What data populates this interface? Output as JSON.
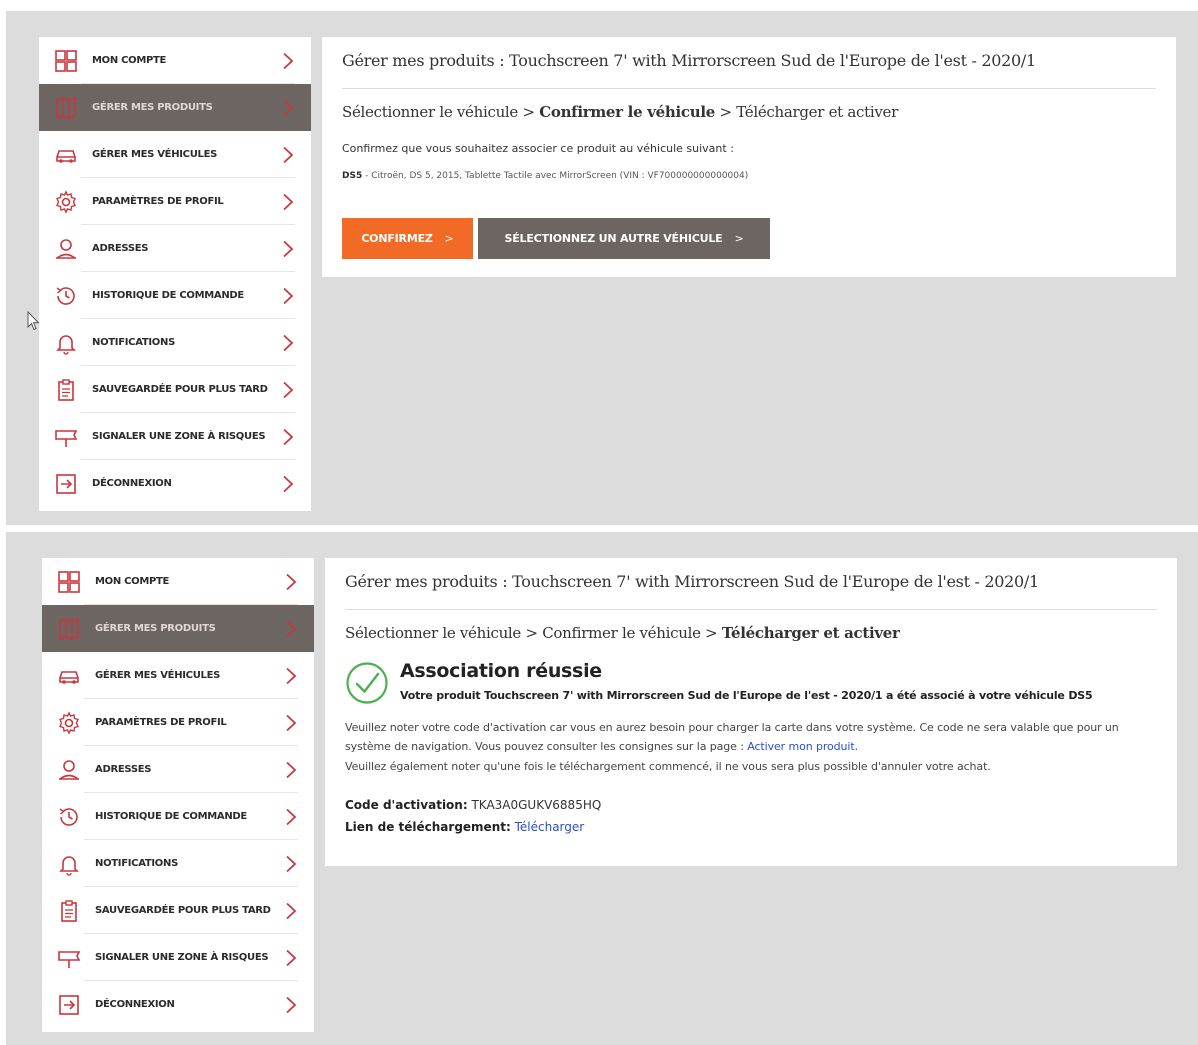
{
  "menu": [
    {
      "label": "MON COMPTE",
      "icon": "account-grid-icon",
      "name": "sidebar-item-mon-compte"
    },
    {
      "label": "GÉRER MES PRODUITS",
      "icon": "map-book-icon",
      "name": "sidebar-item-gerer-mes-produits"
    },
    {
      "label": "GÉRER MES VÉHICULES",
      "icon": "car-icon",
      "name": "sidebar-item-gerer-mes-vehicules"
    },
    {
      "label": "PARAMÈTRES DE PROFIL",
      "icon": "gear-icon",
      "name": "sidebar-item-parametres-de-profil"
    },
    {
      "label": "ADRESSES",
      "icon": "location-user-icon",
      "name": "sidebar-item-adresses"
    },
    {
      "label": "HISTORIQUE DE COMMANDE",
      "icon": "history-icon",
      "name": "sidebar-item-historique-de-commande"
    },
    {
      "label": "NOTIFICATIONS",
      "icon": "bell-icon",
      "name": "sidebar-item-notifications"
    },
    {
      "label": "SAUVEGARDÉE POUR PLUS TARD",
      "icon": "clipboard-icon",
      "name": "sidebar-item-sauvegardee"
    },
    {
      "label": "SIGNALER UNE ZONE À RISQUES",
      "icon": "warning-sign-icon",
      "name": "sidebar-item-signaler-zone"
    },
    {
      "label": "DÉCONNEXION",
      "icon": "logout-icon",
      "name": "sidebar-item-deconnexion"
    }
  ],
  "active_index": 1,
  "colors": {
    "active_bg": "#6c6562",
    "active_text": "#e2d6d4",
    "accent_red": "#c8373f",
    "orange": "#f16a26",
    "success_green": "#4caf50",
    "link": "#2a4ec7"
  },
  "top": {
    "title": "Gérer mes produits : Touchscreen 7' with Mirrorscreen Sud de l'Europe de l'est - 2020/1",
    "steps": {
      "step1": "Sélectionner le véhicule",
      "sep1": " > ",
      "step2": "Confirmer le véhicule",
      "sep2": " > ",
      "step3": "Télécharger et activer"
    },
    "confirm_text": "Confirmez que vous souhaitez associer ce produit au véhicule suivant :",
    "vehicle_model": "DS5",
    "vehicle_details": " - Citroën, DS 5, 2015, Tablette Tactile avec MirrorScreen (VIN : VF700000000000004)",
    "btn_confirm": "CONFIRMEZ",
    "btn_other": "SÉLECTIONNEZ UN AUTRE VÉHICULE",
    "arrow": ">"
  },
  "bottom": {
    "title": "Gérer mes produits : Touchscreen 7' with Mirrorscreen Sud de l'Europe de l'est - 2020/1",
    "steps": {
      "step1": "Sélectionner le véhicule",
      "sep1": " > ",
      "step2": "Confirmer le véhicule",
      "sep2": " > ",
      "step3": "Télécharger et activer"
    },
    "success_title": "Association réussie",
    "success_sub": "Votre produit Touchscreen 7' with Mirrorscreen Sud de l'Europe de l'est - 2020/1 a été associé à votre véhicule DS5",
    "note1_text": "Veuillez noter votre code d'activation car vous en aurez besoin pour charger la carte dans votre système. Ce code ne sera valable que pour un système de navigation. Vous pouvez consulter les consignes sur la page : ",
    "note1_link": "Activer mon produit.",
    "note2_text": "Veuillez également noter qu'une fois le téléchargement commencé, il ne vous sera plus possible d'annuler votre achat.",
    "code_label": "Code d'activation:",
    "code_value": " TKA3A0GUKV6885HQ",
    "dl_label": "Lien de téléchargement:",
    "dl_link": "Télécharger"
  }
}
